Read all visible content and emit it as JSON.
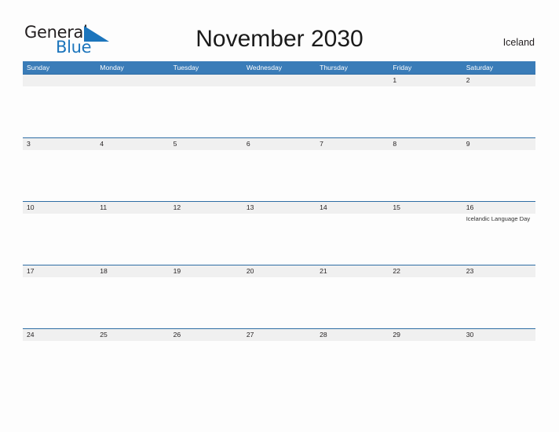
{
  "brand": {
    "name_part1": "General",
    "name_part2": "Blue",
    "flag_icon": "blue-triangle-flag-icon",
    "color_dark": "#231f20",
    "color_blue": "#1c75bc"
  },
  "header": {
    "title": "November 2030",
    "country": "Iceland"
  },
  "theme": {
    "header_blue": "#3a7cb8",
    "rule_blue": "#2e6da4",
    "band_gray": "#f0f0f0",
    "page_bg": "#fdfdfd",
    "text": "#231f20",
    "event_text": "#333333"
  },
  "calendar": {
    "month": "November",
    "year": "2030",
    "weekday_headers": [
      "Sunday",
      "Monday",
      "Tuesday",
      "Wednesday",
      "Thursday",
      "Friday",
      "Saturday"
    ],
    "weeks": [
      {
        "days": [
          {
            "num": "",
            "event": ""
          },
          {
            "num": "",
            "event": ""
          },
          {
            "num": "",
            "event": ""
          },
          {
            "num": "",
            "event": ""
          },
          {
            "num": "",
            "event": ""
          },
          {
            "num": "1",
            "event": ""
          },
          {
            "num": "2",
            "event": ""
          }
        ]
      },
      {
        "days": [
          {
            "num": "3",
            "event": ""
          },
          {
            "num": "4",
            "event": ""
          },
          {
            "num": "5",
            "event": ""
          },
          {
            "num": "6",
            "event": ""
          },
          {
            "num": "7",
            "event": ""
          },
          {
            "num": "8",
            "event": ""
          },
          {
            "num": "9",
            "event": ""
          }
        ]
      },
      {
        "days": [
          {
            "num": "10",
            "event": ""
          },
          {
            "num": "11",
            "event": ""
          },
          {
            "num": "12",
            "event": ""
          },
          {
            "num": "13",
            "event": ""
          },
          {
            "num": "14",
            "event": ""
          },
          {
            "num": "15",
            "event": ""
          },
          {
            "num": "16",
            "event": "Icelandic Language Day"
          }
        ]
      },
      {
        "days": [
          {
            "num": "17",
            "event": ""
          },
          {
            "num": "18",
            "event": ""
          },
          {
            "num": "19",
            "event": ""
          },
          {
            "num": "20",
            "event": ""
          },
          {
            "num": "21",
            "event": ""
          },
          {
            "num": "22",
            "event": ""
          },
          {
            "num": "23",
            "event": ""
          }
        ]
      },
      {
        "days": [
          {
            "num": "24",
            "event": ""
          },
          {
            "num": "25",
            "event": ""
          },
          {
            "num": "26",
            "event": ""
          },
          {
            "num": "27",
            "event": ""
          },
          {
            "num": "28",
            "event": ""
          },
          {
            "num": "29",
            "event": ""
          },
          {
            "num": "30",
            "event": ""
          }
        ]
      }
    ]
  }
}
